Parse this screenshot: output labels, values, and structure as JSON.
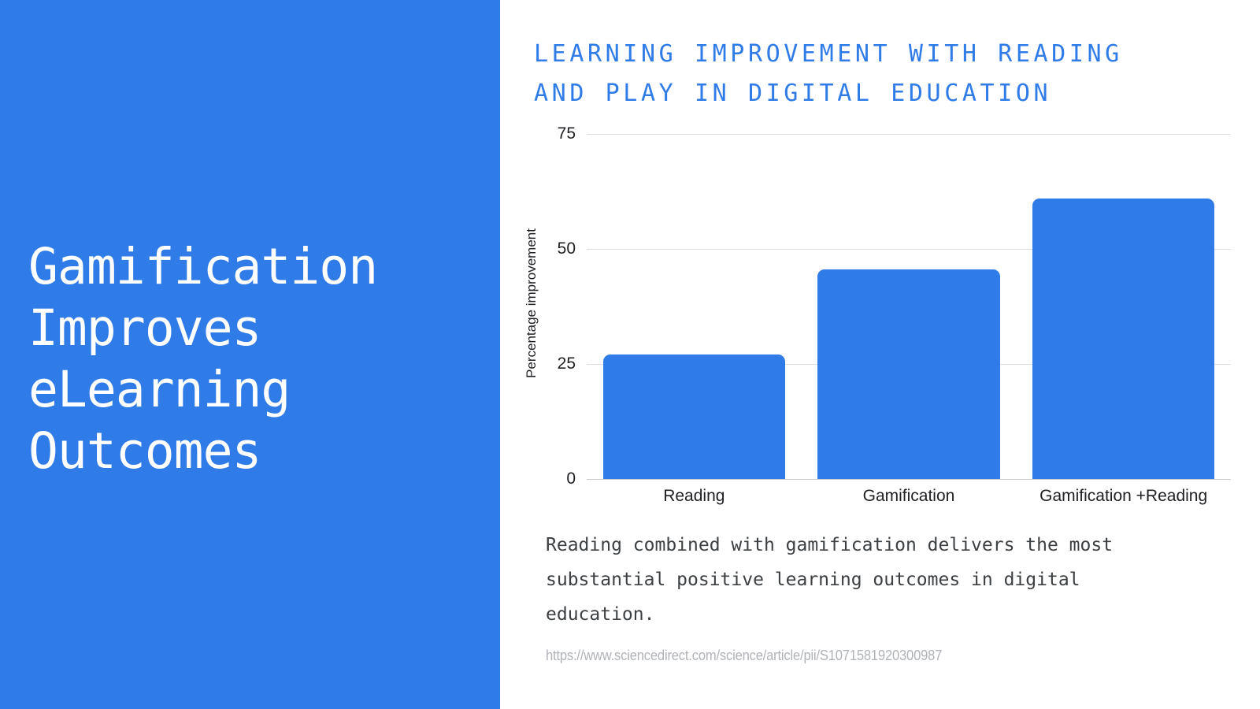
{
  "theme": {
    "brand_blue": "#2F7BE8",
    "panel_background": "#FFFFFF",
    "text_dark": "#202124",
    "caption_gray": "#3C4043",
    "source_gray": "#B0B3B8",
    "gridline_gray": "#DDDDDD"
  },
  "left_panel": {
    "headline": "Gamification\nImproves\neLearning\nOutcomes"
  },
  "right_panel": {
    "chart_title": "LEARNING IMPROVEMENT WITH READING\nAND PLAY IN DIGITAL EDUCATION",
    "caption": "Reading combined with gamification delivers the most substantial positive learning outcomes in digital education.",
    "source_url": "https://www.sciencedirect.com/science/article/pii/S1071581920300987"
  },
  "chart_data": {
    "type": "bar",
    "title": "LEARNING IMPROVEMENT WITH READING AND PLAY IN DIGITAL EDUCATION",
    "categories": [
      "Reading",
      "Gamification",
      "Gamification +Reading"
    ],
    "values": [
      27,
      45.5,
      61
    ],
    "series": [
      {
        "name": "Percentage improvement",
        "values": [
          27,
          45.5,
          61
        ]
      }
    ],
    "xlabel": "",
    "ylabel": "Percentage improvement",
    "ylim": [
      0,
      75
    ],
    "yticks": [
      0,
      25,
      50,
      75
    ],
    "ytick_labels": [
      "0",
      "25",
      "50",
      "75"
    ],
    "grid": true,
    "legend": false,
    "bar_color": "#2F7BE8"
  }
}
